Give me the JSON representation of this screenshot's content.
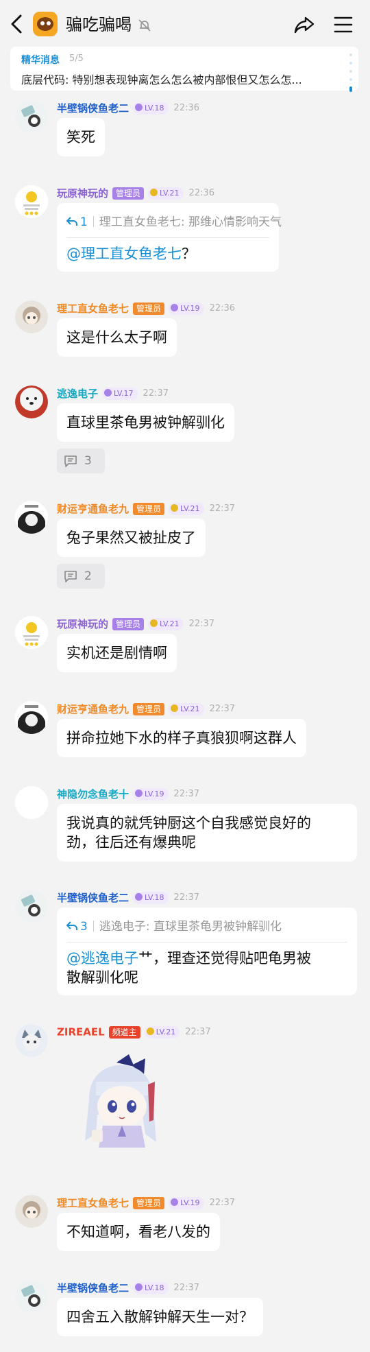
{
  "header": {
    "title": "骗吃骗喝",
    "back_icon": "back-arrow-icon",
    "mute_icon": "bell-off-icon",
    "share_icon": "share-icon",
    "menu_icon": "hamburger-menu-icon"
  },
  "pinned": {
    "label": "精华消息",
    "count": "5/5",
    "text": "底层代码: 特别想表现钟离怎么怎么被内部恨但又怎么怎..."
  },
  "messages": [
    {
      "name": "半壁锅侠鱼老二",
      "level": "LV.18",
      "time": "22:36",
      "text": "笑死"
    },
    {
      "name": "玩原神玩的",
      "badge": "管理员",
      "level": "LV.21",
      "time": "22:36",
      "quote_count": "1",
      "quote_text": "理工直女鱼老七: 那维心情影响天气",
      "mention": "@理工直女鱼老七",
      "text": "？"
    },
    {
      "name": "理工直女鱼老七",
      "badge": "管理员",
      "level": "LV.19",
      "time": "22:36",
      "text": "这是什么太子啊"
    },
    {
      "name": "逃逸电子",
      "level": "LV.17",
      "time": "22:37",
      "text": "直球里茶龟男被钟解驯化",
      "thread_count": "3"
    },
    {
      "name": "财运亨通鱼老九",
      "badge": "管理员",
      "level": "LV.21",
      "time": "22:37",
      "text": "兔子果然又被扯皮了",
      "thread_count": "2"
    },
    {
      "name": "玩原神玩的",
      "badge": "管理员",
      "level": "LV.21",
      "time": "22:37",
      "text": "实机还是剧情啊"
    },
    {
      "name": "财运亨通鱼老九",
      "badge": "管理员",
      "level": "LV.21",
      "time": "22:37",
      "text": "拼命拉她下水的样子真狼狈啊这群人"
    },
    {
      "name": "神隐勿念鱼老十",
      "level": "LV.19",
      "time": "22:37",
      "text_line1": "我说真的就凭钟厨这个自我感觉良好的",
      "text_line2": "劲，往后还有爆典呢"
    },
    {
      "name": "半壁锅侠鱼老二",
      "level": "LV.18",
      "time": "22:37",
      "quote_count": "3",
      "quote_text": "逃逸电子: 直球里茶龟男被钟解驯化",
      "mention": "@逃逸电子",
      "text_line1": "艹，理查还觉得贴吧龟男被",
      "text_line2": "散解驯化呢"
    },
    {
      "name": "ZIREAEL",
      "badge": "频道主",
      "level": "LV.21",
      "time": "22:37",
      "sticker": "anime-girl-sticker"
    },
    {
      "name": "理工直女鱼老七",
      "badge": "管理员",
      "level": "LV.19",
      "time": "22:37",
      "text": "不知道啊，看老八发的"
    },
    {
      "name": "半壁锅侠鱼老二",
      "level": "LV.18",
      "time": "22:37",
      "text": "四舍五入散解钟解天生一对？"
    }
  ]
}
